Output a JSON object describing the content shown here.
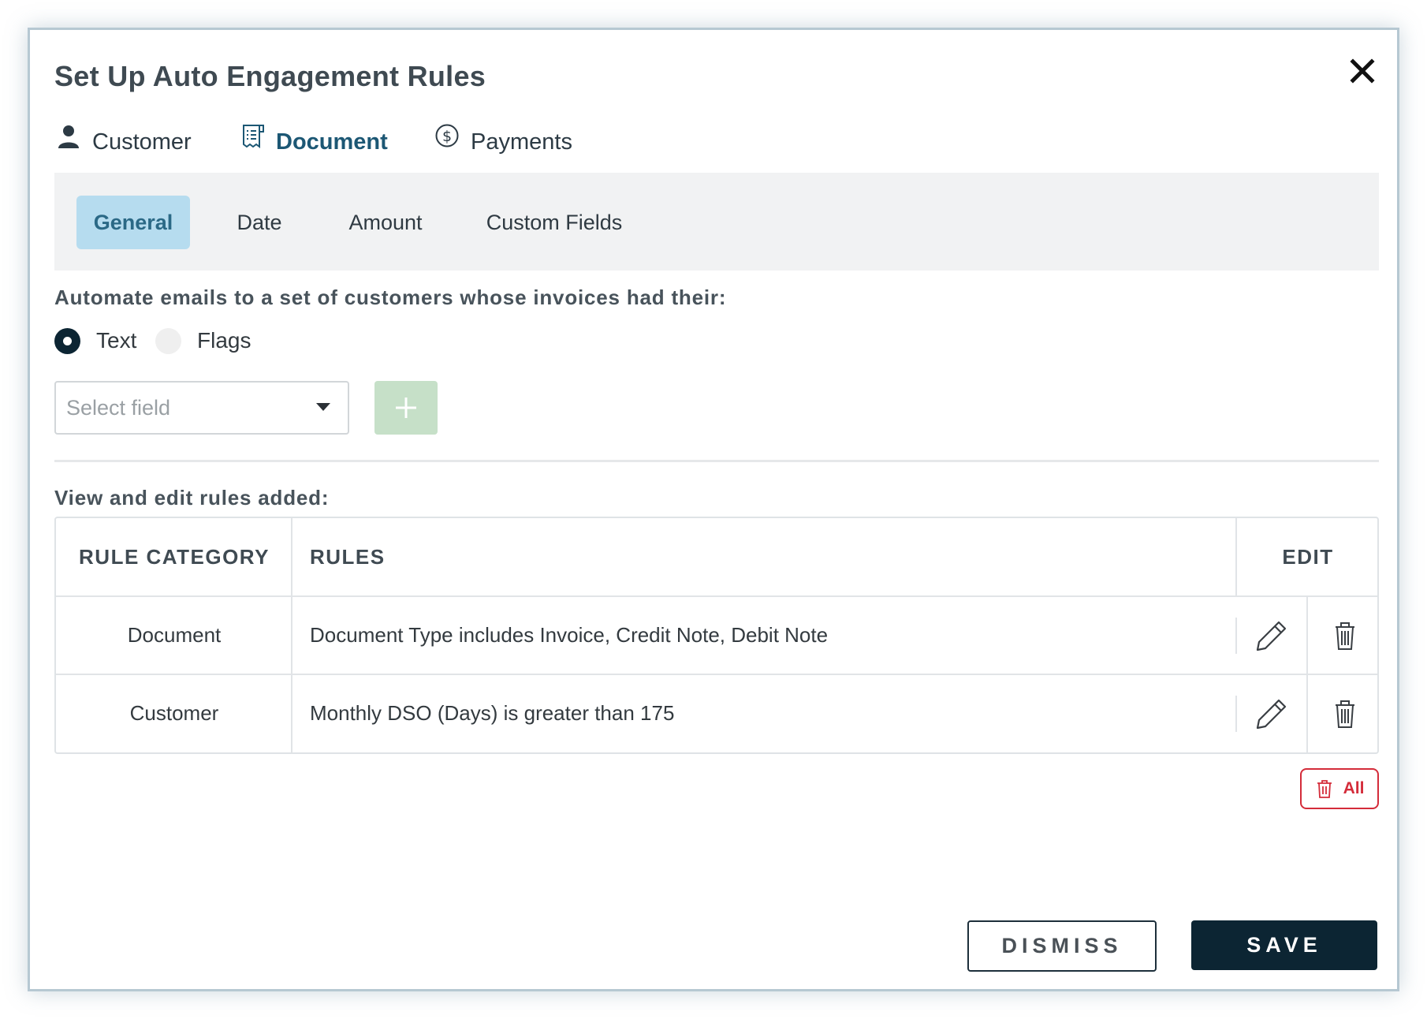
{
  "modal": {
    "title": "Set Up Auto Engagement Rules",
    "close_icon": "close-icon"
  },
  "tabs": [
    {
      "label": "Customer",
      "icon": "person-icon",
      "active": false
    },
    {
      "label": "Document",
      "icon": "document-icon",
      "active": true
    },
    {
      "label": "Payments",
      "icon": "dollar-circle-icon",
      "active": false
    }
  ],
  "subtabs": [
    {
      "label": "General",
      "active": true
    },
    {
      "label": "Date",
      "active": false
    },
    {
      "label": "Amount",
      "active": false
    },
    {
      "label": "Custom Fields",
      "active": false
    }
  ],
  "automate": {
    "label": "Automate emails to a set of customers whose invoices had their:",
    "options": [
      {
        "label": "Text",
        "checked": true
      },
      {
        "label": "Flags",
        "checked": false
      }
    ],
    "select_placeholder": "Select field",
    "add_icon": "plus-icon"
  },
  "rules_section": {
    "label": "View and edit rules added:",
    "headers": {
      "category": "RULE CATEGORY",
      "rules": "RULES",
      "edit": "EDIT"
    },
    "rows": [
      {
        "category": "Document",
        "rule": "Document Type includes Invoice, Credit Note, Debit Note"
      },
      {
        "category": "Customer",
        "rule": "Monthly DSO (Days) is greater than 175"
      }
    ],
    "delete_all_label": "All"
  },
  "footer": {
    "dismiss_label": "DISMISS",
    "save_label": "SAVE"
  },
  "colors": {
    "primary_dark": "#0c2533",
    "active_tab_text": "#1c5774",
    "active_subtab_bg": "#b6dcef",
    "add_button_bg": "#c6e0c8",
    "danger": "#d42c3a"
  }
}
